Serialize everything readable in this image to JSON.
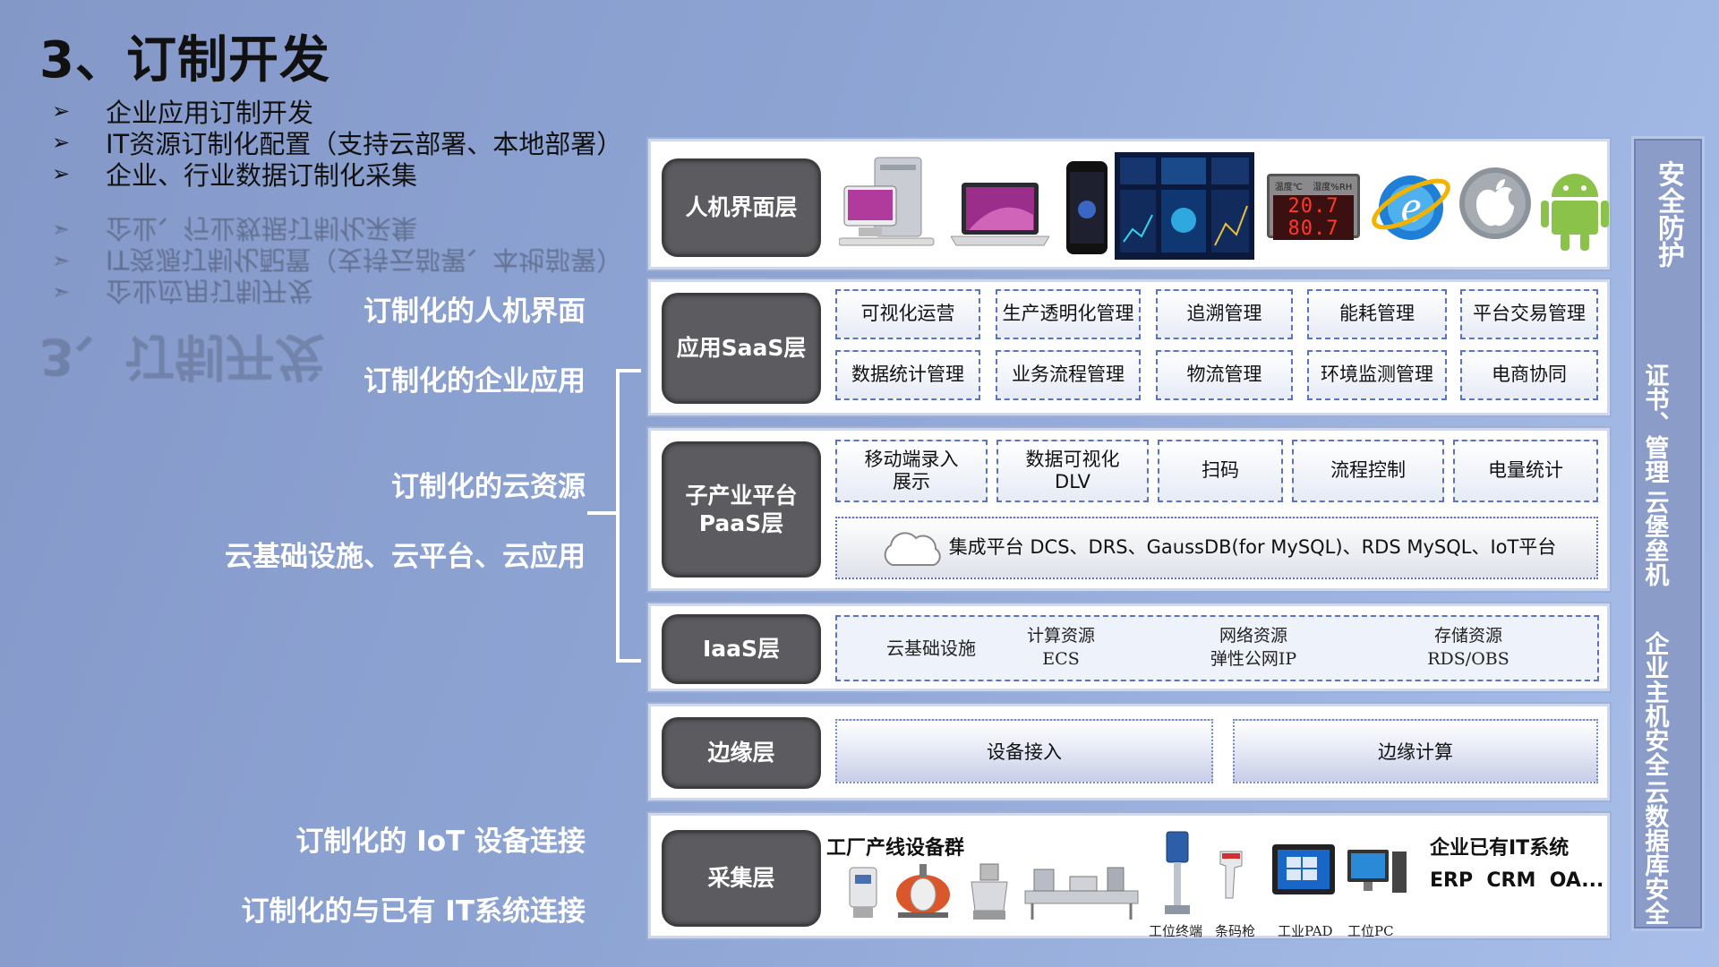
{
  "title": "3、订制开发",
  "bullets": [
    "企业应用订制开发",
    "IT资源订制化配置（支持云部署、本地部署）",
    "企业、行业数据订制化采集"
  ],
  "bullet_marker": "➢",
  "left_labels": {
    "hmi": "订制化的人机界面",
    "app": "订制化的企业应用",
    "cloud": "订制化的云资源",
    "infra": "云基础设施、云平台、云应用",
    "iot": "订制化的 IoT 设备连接",
    "it": "订制化的与已有 IT系统连接"
  },
  "layers": {
    "hmi": {
      "name": "人机界面层",
      "icons": [
        "desktop-computer-icon",
        "laptop-icon",
        "smartphone-icon",
        "dashboard-screen-icon",
        "led-display-icon",
        "internet-explorer-icon",
        "apple-icon",
        "android-icon"
      ],
      "led_text": "20.7 80.7",
      "led_labels": [
        "温度℃",
        "湿度%RH"
      ]
    },
    "saas": {
      "name": "应用SaaS层",
      "row1": [
        "可视化运营",
        "生产透明化管理",
        "追溯管理",
        "能耗管理",
        "平台交易管理"
      ],
      "row2": [
        "数据统计管理",
        "业务流程管理",
        "物流管理",
        "环境监测管理",
        "电商协同"
      ]
    },
    "paas": {
      "name": "子产业平台\nPaaS层",
      "modules": [
        "移动端录入\n展示",
        "数据可视化\nDLV",
        "扫码",
        "流程控制",
        "电量统计"
      ],
      "integration": "集成平台 DCS、DRS、GaussDB(for MySQL)、RDS MySQL、IoT平台"
    },
    "iaas": {
      "name": "IaaS层",
      "infra": "云基础设施",
      "items": [
        {
          "a": "计算资源",
          "b": "ECS"
        },
        {
          "a": "网络资源",
          "b": "弹性公网IP"
        },
        {
          "a": "存储资源",
          "b": "RDS/OBS"
        }
      ]
    },
    "edge": {
      "name": "边缘层",
      "boxes": [
        "设备接入",
        "边缘计算"
      ]
    },
    "collect": {
      "name": "采集层",
      "factory": "工厂产线设备群",
      "devices": [
        "工位终端",
        "条码枪",
        "工业PAD",
        "工位PC"
      ],
      "it_title": "企业已有IT系统",
      "it_systems": "ERP  CRM  OA..."
    }
  },
  "side": {
    "title": "安全防护",
    "items": [
      "证书、管理",
      "云堡垒机",
      "企业主机安全",
      "云数据库安全"
    ]
  },
  "colors": {
    "background": "#8ea5d4",
    "layer_label": "#5c5c60",
    "dashed": "#5a72c8"
  }
}
